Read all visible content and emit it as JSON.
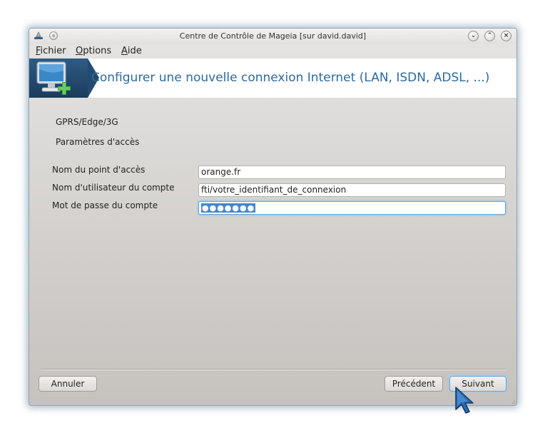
{
  "window": {
    "title": "Centre de Contrôle de Mageia  [sur david.david]",
    "min_glyph": "⌄",
    "max_glyph": "⌃",
    "close_glyph": "×"
  },
  "menu": {
    "file": {
      "mnemonic": "F",
      "rest": "ichier"
    },
    "options": {
      "mnemonic": "O",
      "rest": "ptions"
    },
    "help": {
      "mnemonic": "A",
      "rest": "ide"
    }
  },
  "banner": {
    "title": "Configurer une nouvelle connexion Internet (LAN, ISDN, ADSL, ...)",
    "icon": "network-monitor-add-icon"
  },
  "content": {
    "connection_type": "GPRS/Edge/3G",
    "section_title": "Paramètres d'accès",
    "fields": [
      {
        "label": "Nom du point d'accès",
        "value": "orange.fr"
      },
      {
        "label": "Nom d'utilisateur du compte",
        "value": "fti/votre_identifiant_de_connexion"
      },
      {
        "label": "Mot de passe du compte",
        "value": "●●●●●●●"
      }
    ]
  },
  "buttons": {
    "cancel": "Annuler",
    "previous": "Précédent",
    "next": "Suivant"
  },
  "colors": {
    "accent": "#2d6a9e",
    "focus": "#6aa6d8",
    "selection": "#3d8ad4"
  }
}
